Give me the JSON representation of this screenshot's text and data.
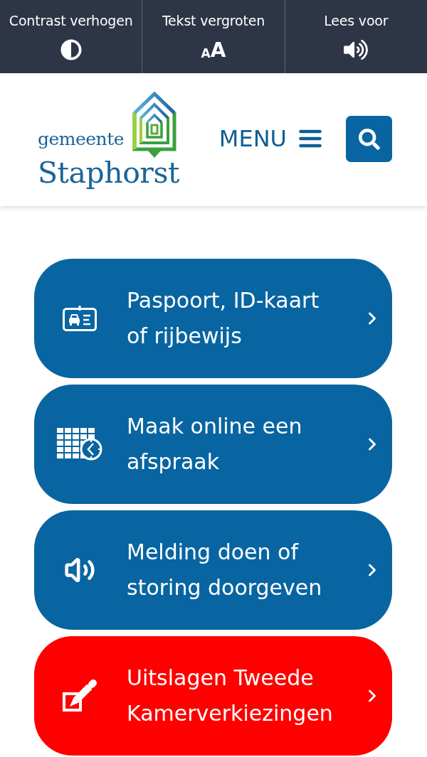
{
  "accessibility_bar": {
    "items": [
      {
        "kind": "contrast",
        "label": "Contrast verhogen"
      },
      {
        "kind": "text-size",
        "label": "Tekst vergroten",
        "glyph": [
          "A",
          "A"
        ]
      },
      {
        "kind": "read-aloud",
        "label": "Lees voor"
      }
    ]
  },
  "header": {
    "logo": {
      "subtitle": "gemeente",
      "title": "Staphorst"
    },
    "menu_button": {
      "label": "MENU"
    }
  },
  "tiles": [
    {
      "kind": "id-card",
      "label": "Paspoort, ID-kaart\nof rijbewijs",
      "color": "#0865a1"
    },
    {
      "kind": "calendar-clock",
      "label": "Maak online een\nafspraak",
      "color": "#0865a1"
    },
    {
      "kind": "speaker",
      "label": "Melding doen of\nstoring doorgeven",
      "color": "#0865a1"
    },
    {
      "kind": "pencil-check",
      "label": "Uitslagen Tweede\nKamerverkiezingen",
      "color": "#ff0000"
    }
  ]
}
